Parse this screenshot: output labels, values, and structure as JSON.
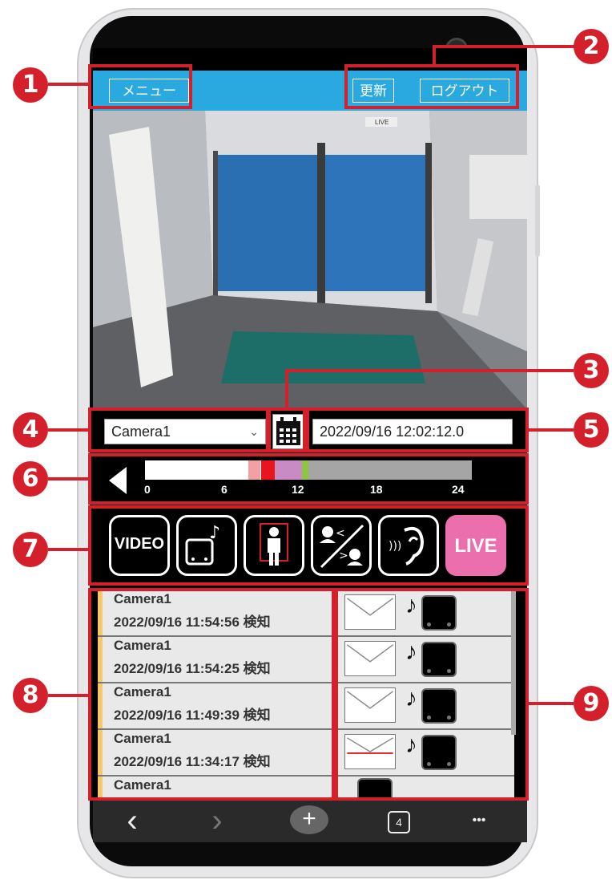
{
  "header": {
    "menu_label": "メニュー",
    "refresh_label": "更新",
    "logout_label": "ログアウト"
  },
  "overlay": {
    "camera_tag": "LIVE"
  },
  "controls": {
    "camera_select": "Camera1",
    "datetime": "2022/09/16 12:02:12.0"
  },
  "timeline": {
    "ticks": [
      "0",
      "6",
      "12",
      "18",
      "24"
    ],
    "segments": [
      {
        "from_hour": 7.6,
        "to_hour": 8.5,
        "color": "#f2a0a6"
      },
      {
        "from_hour": 8.5,
        "to_hour": 9.5,
        "color": "#e8151e"
      },
      {
        "from_hour": 9.5,
        "to_hour": 11.5,
        "color": "#c98bc4"
      },
      {
        "from_hour": 11.5,
        "to_hour": 12.0,
        "color": "#8fc63f"
      },
      {
        "from_hour": 12.0,
        "to_hour": 24.0,
        "color": "#a5a5a5"
      }
    ]
  },
  "mode_icons": [
    {
      "label": "VIDEO",
      "icon": "video-icon"
    },
    {
      "label": "",
      "icon": "robot-music-icon"
    },
    {
      "label": "",
      "icon": "person-detect-icon"
    },
    {
      "label": "",
      "icon": "voice-conversation-icon"
    },
    {
      "label": "",
      "icon": "ear-listen-icon"
    },
    {
      "label": "LIVE",
      "icon": "live-icon"
    }
  ],
  "events": [
    {
      "camera": "Camera1",
      "timestamp": "2022/09/16 11:54:56 検知"
    },
    {
      "camera": "Camera1",
      "timestamp": "2022/09/16 11:54:25 検知"
    },
    {
      "camera": "Camera1",
      "timestamp": "2022/09/16 11:49:39 検知"
    },
    {
      "camera": "Camera1",
      "timestamp": "2022/09/16 11:34:17 検知"
    },
    {
      "camera": "Camera1",
      "timestamp": ""
    }
  ],
  "browser_nav": {
    "back": "‹",
    "forward": "›",
    "add": "+",
    "tabs": "4",
    "more": "•••"
  },
  "annotations": [
    "1",
    "2",
    "3",
    "4",
    "5",
    "6",
    "7",
    "8",
    "9"
  ],
  "colors": {
    "header": "#2aa9e0",
    "live": "#ec6fad",
    "annotation": "#d4202a",
    "accent": "#f6c86b"
  }
}
